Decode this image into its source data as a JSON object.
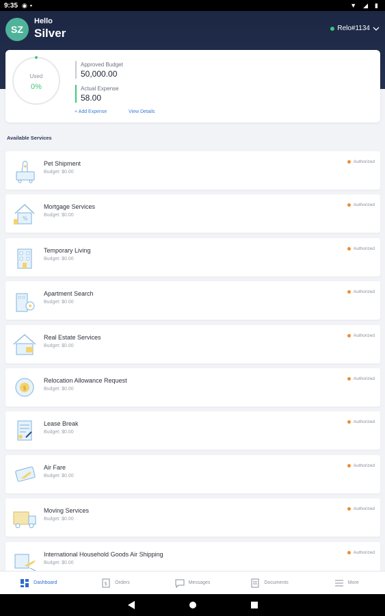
{
  "status_bar": {
    "time": "9:35"
  },
  "header": {
    "avatar_initials": "SZ",
    "greeting": "Hello",
    "name": "Silver",
    "relo_id": "Relo#1134"
  },
  "budget": {
    "used_label": "Used",
    "used_percent": "0%",
    "approved_label": "Approved Budget",
    "approved_value": "50,000.00",
    "actual_label": "Actual Expense",
    "actual_value": "58.00",
    "add_expense": "+ Add Expense",
    "view_details": "View Details"
  },
  "section_title": "Available Services",
  "services": [
    {
      "name": "Pet Shipment",
      "budget": "Budget: $0.00",
      "status": "Authorized",
      "icon": "pet-shipment-icon"
    },
    {
      "name": "Mortgage Services",
      "budget": "Budget: $0.00",
      "status": "Authorized",
      "icon": "mortgage-icon"
    },
    {
      "name": "Temporary Living",
      "budget": "Budget: $0.00",
      "status": "Authorized",
      "icon": "temporary-living-icon"
    },
    {
      "name": "Apartment Search",
      "budget": "Budget: $0.00",
      "status": "Authorized",
      "icon": "apartment-search-icon"
    },
    {
      "name": "Real Estate Services",
      "budget": "Budget: $0.00",
      "status": "Authorized",
      "icon": "real-estate-icon"
    },
    {
      "name": "Relocation Allowance Request",
      "budget": "Budget: $0.00",
      "status": "Authorized",
      "icon": "allowance-icon"
    },
    {
      "name": "Lease Break",
      "budget": "Budget: $0.00",
      "status": "Authorized",
      "icon": "lease-break-icon"
    },
    {
      "name": "Air Fare",
      "budget": "Budget: $0.00",
      "status": "Authorized",
      "icon": "air-fare-icon"
    },
    {
      "name": "Moving Services",
      "budget": "Budget: $0.00",
      "status": "Authorized",
      "icon": "moving-truck-icon"
    },
    {
      "name": "International Household Goods Air Shipping",
      "budget": "Budget: $0.00",
      "status": "Authorized",
      "icon": "air-shipping-icon"
    }
  ],
  "nav": {
    "dashboard": "Dashboard",
    "orders": "Orders",
    "messages": "Messages",
    "documents": "Documents",
    "more": "More"
  },
  "colors": {
    "header_bg": "#1c2744",
    "accent_green": "#3cc77a",
    "status_orange": "#f28a2e",
    "link_blue": "#3a7bd5"
  }
}
